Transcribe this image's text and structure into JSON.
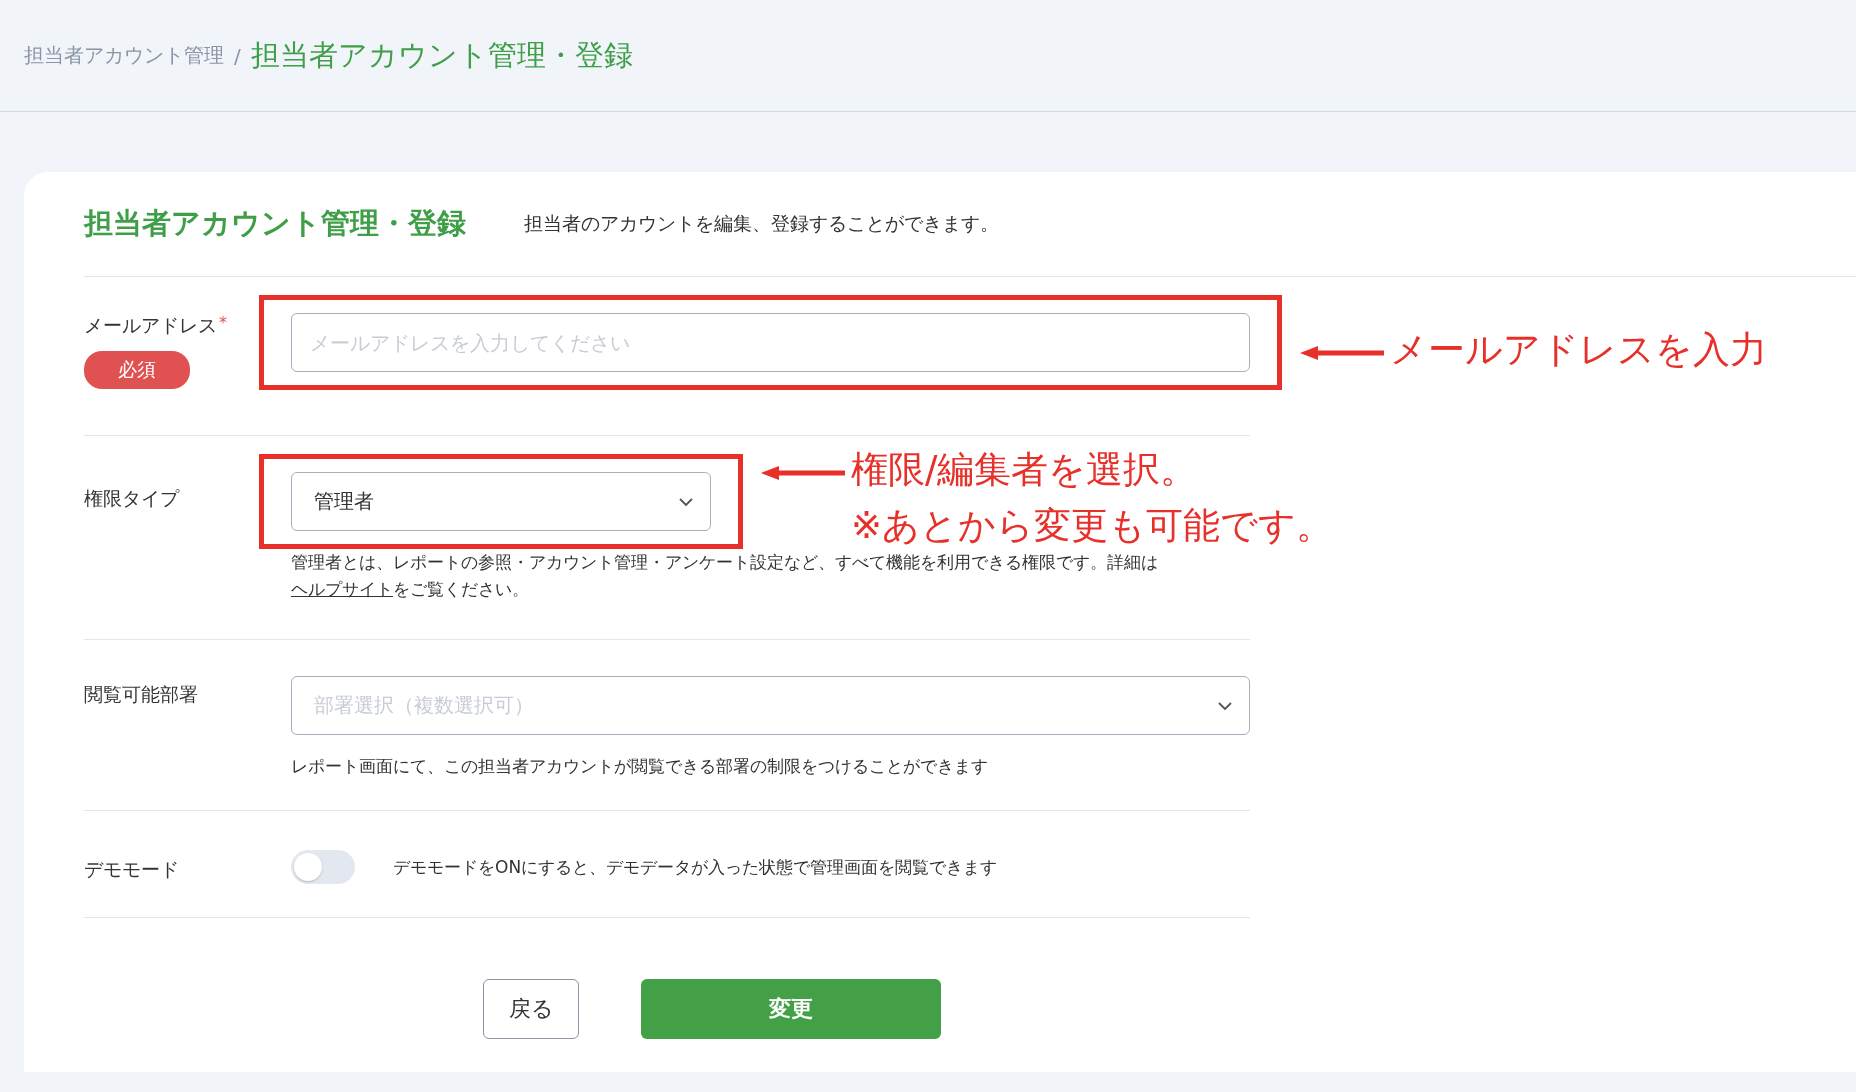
{
  "breadcrumb": {
    "separator": "/",
    "items": [
      {
        "label": "担当者アカウント管理",
        "current": false
      },
      {
        "label": "担当者アカウント管理・登録",
        "current": true
      }
    ]
  },
  "page": {
    "title": "担当者アカウント管理・登録",
    "description": "担当者のアカウントを編集、登録することができます。"
  },
  "form": [
    {
      "kind": "text",
      "label": "メールアドレス",
      "required_mark": "*",
      "badge": "必須",
      "placeholder": "メールアドレスを入力してください",
      "highlighted": true,
      "callout": [
        "メールアドレスを入力"
      ]
    },
    {
      "kind": "select",
      "label": "権限タイプ",
      "value": "管理者",
      "help": "管理者とは、レポートの参照・アカウント管理・アンケート設定など、すべて機能を利用できる権限です。詳細は",
      "help_link": "ヘルプサイト",
      "help_after": "をご覧ください。",
      "highlighted": true,
      "callout": [
        "権限/編集者を選択。",
        "※あとから変更も可能です。"
      ]
    },
    {
      "kind": "multiselect",
      "label": "閲覧可能部署",
      "placeholder": "部署選択（複数選択可）",
      "help": "レポート画面にて、この担当者アカウントが閲覧できる部署の制限をつけることができます"
    },
    {
      "kind": "toggle",
      "label": "デモモード",
      "on": false,
      "help": "デモモードをONにすると、デモデータが入った状態で管理画面を閲覧できます"
    }
  ],
  "buttons": [
    {
      "label": "戻る",
      "kind": "secondary"
    },
    {
      "label": "変更",
      "kind": "primary"
    }
  ]
}
